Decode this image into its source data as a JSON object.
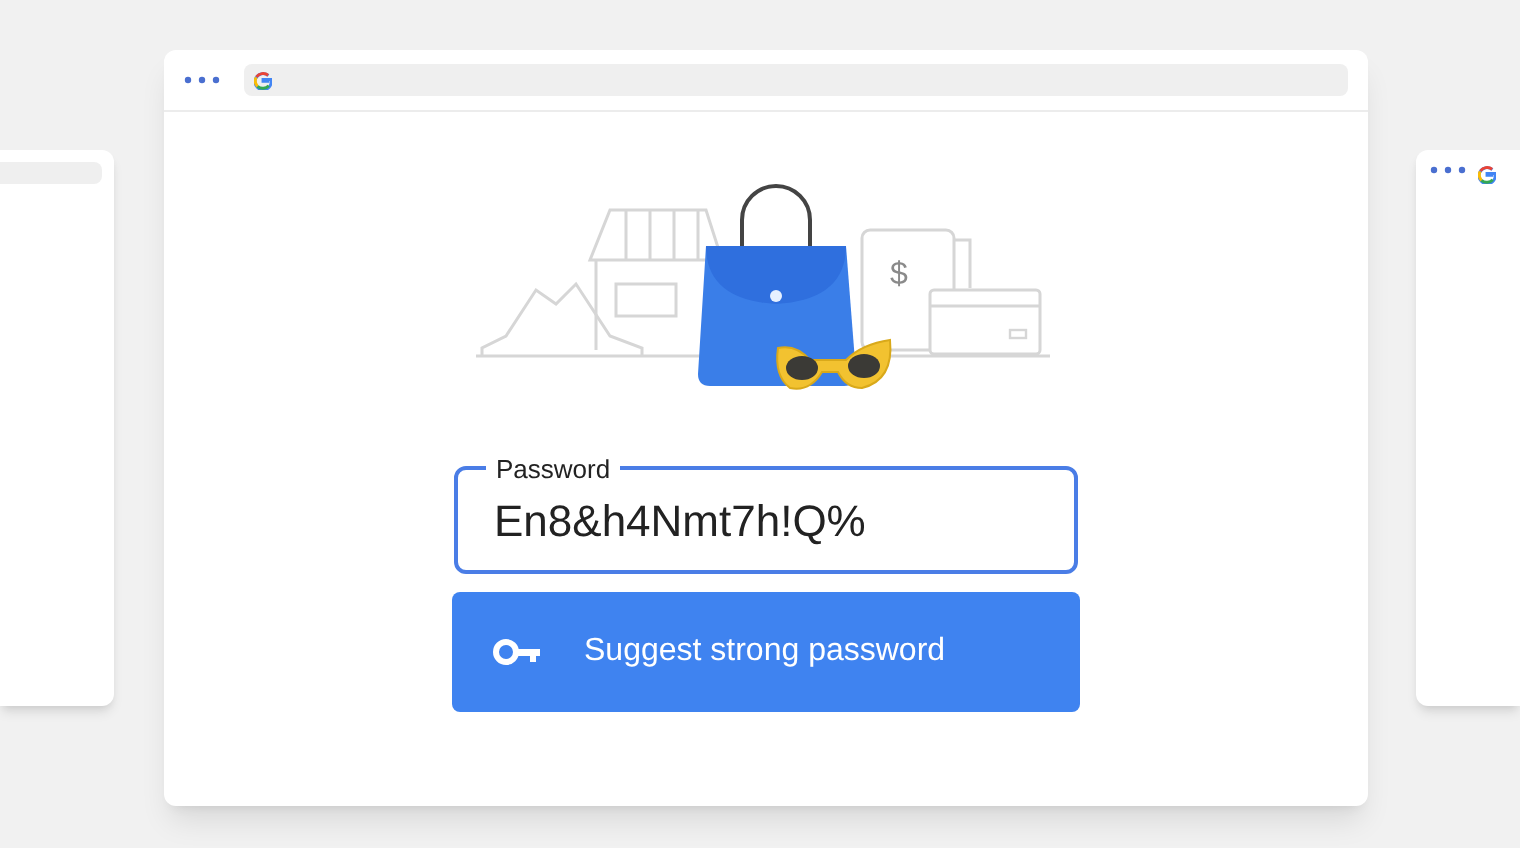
{
  "illustration": {
    "receipt_symbol": "$"
  },
  "password_field": {
    "label": "Password",
    "value": "En8&h4Nmt7h!Q%"
  },
  "suggest_button": {
    "label": "Suggest strong password"
  }
}
